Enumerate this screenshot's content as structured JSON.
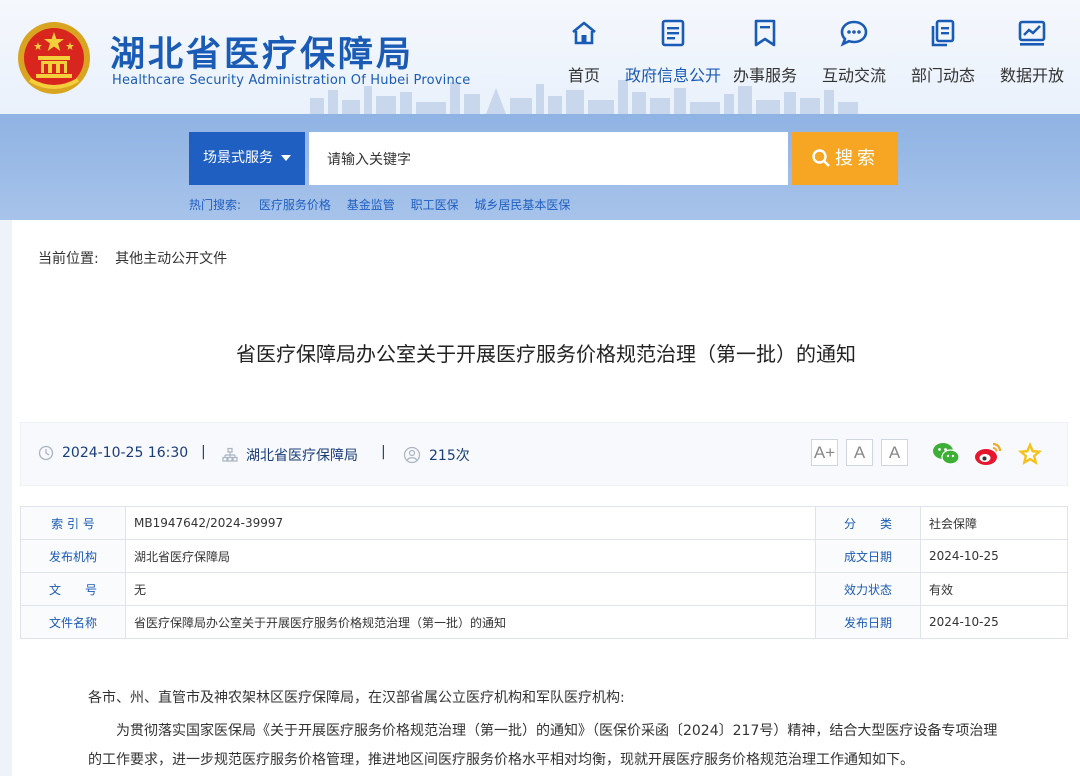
{
  "header": {
    "site_title": "湖北省医疗保障局",
    "site_subtitle": "Healthcare Security Administration Of Hubei Province",
    "nav": [
      {
        "label": "首页",
        "icon": "home-icon"
      },
      {
        "label": "政府信息公开",
        "icon": "document-icon",
        "active": true
      },
      {
        "label": "办事服务",
        "icon": "bookmark-icon"
      },
      {
        "label": "互动交流",
        "icon": "chat-icon"
      },
      {
        "label": "部门动态",
        "icon": "copy-icon"
      },
      {
        "label": "数据开放",
        "icon": "chart-icon"
      }
    ]
  },
  "search": {
    "category": "场景式服务",
    "placeholder": "请输入关键字",
    "button": "搜索",
    "hot_label": "热门搜索:",
    "hot_terms": [
      "医疗服务价格",
      "基金监管",
      "职工医保",
      "城乡居民基本医保"
    ]
  },
  "breadcrumb": {
    "label": "当前位置:",
    "current": "其他主动公开文件"
  },
  "article": {
    "title": "省医疗保障局办公室关于开展医疗服务价格规范治理（第一批）的通知",
    "meta": {
      "datetime": "2024-10-25 16:30",
      "publisher": "湖北省医疗保障局",
      "views": "215次"
    },
    "info": [
      {
        "k1": "索 引 号",
        "v1": "MB1947642/2024-39997",
        "k2": "分　　类",
        "v2": "社会保障"
      },
      {
        "k1": "发布机构",
        "v1": "湖北省医疗保障局",
        "k2": "成文日期",
        "v2": "2024-10-25"
      },
      {
        "k1": "文　　号",
        "v1": "无",
        "k2": "效力状态",
        "v2": "有效"
      },
      {
        "k1": "文件名称",
        "v1": "省医疗保障局办公室关于开展医疗服务价格规范治理（第一批）的通知",
        "k2": "发布日期",
        "v2": "2024-10-25"
      }
    ],
    "salutation": "各市、州、直管市及神农架林区医疗保障局，在汉部省属公立医疗机构和军队医疗机构:",
    "paragraph1": "为贯彻落实国家医保局《关于开展医疗服务价格规范治理（第一批）的通知》（医保价采函〔2024〕217号）精神，结合大型医疗设备专项治理的工作要求，进一步规范医疗服务价格管理，推进地区间医疗服务价格水平相对均衡，现就开展医疗服务价格规范治理工作通知如下。"
  },
  "font_size_buttons": [
    "A+",
    "A",
    "A"
  ],
  "colors": {
    "brand_blue": "#1a5bb5",
    "search_orange": "#f6a623",
    "category_blue": "#1f5fc1"
  }
}
